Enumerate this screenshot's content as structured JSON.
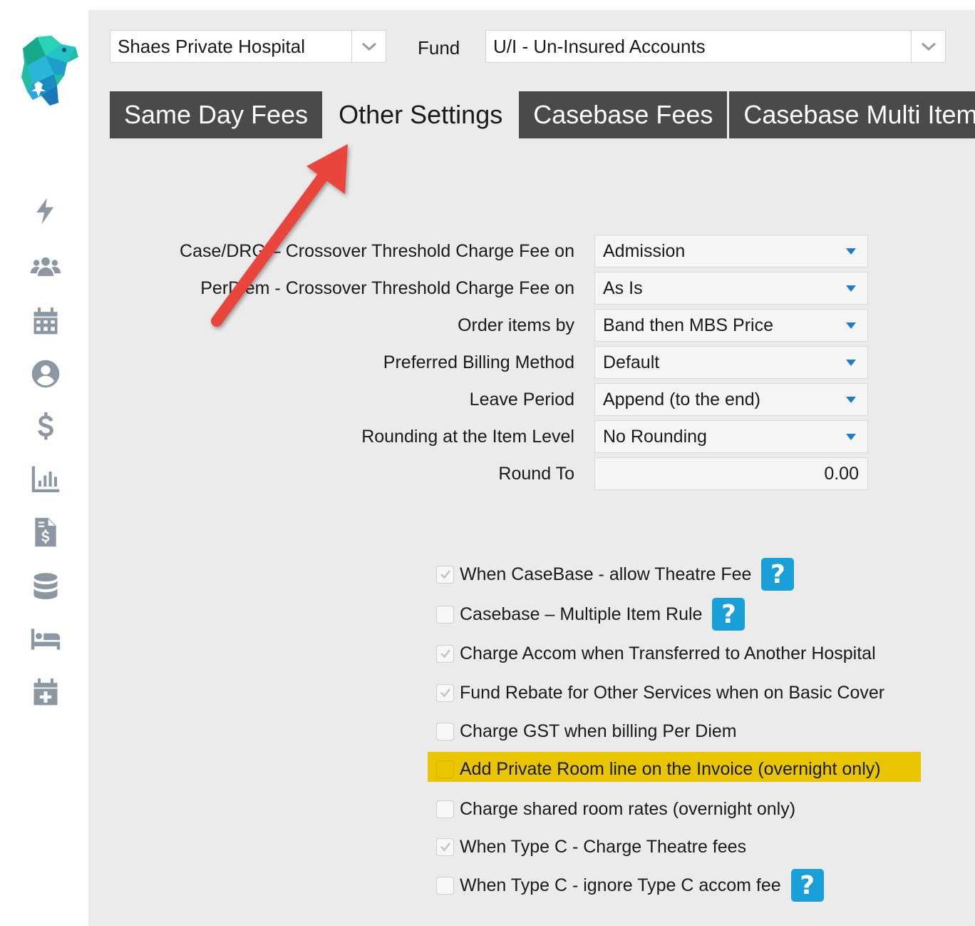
{
  "header": {
    "hospital_select": {
      "value": "Shaes Private Hospital"
    },
    "fund_label": "Fund",
    "fund_select": {
      "value": "U/I - Un-Insured Accounts"
    }
  },
  "tabs": [
    {
      "label": "Same Day Fees",
      "active": false
    },
    {
      "label": "Other Settings",
      "active": true
    },
    {
      "label": "Casebase Fees",
      "active": false
    },
    {
      "label": "Casebase Multi Item",
      "active": false
    }
  ],
  "sidebar": {
    "icons": [
      "bolt-icon",
      "users-icon",
      "calendar-icon",
      "user-circle-icon",
      "dollar-icon",
      "bar-chart-icon",
      "invoice-icon",
      "database-icon",
      "bed-icon",
      "calendar-plus-icon"
    ]
  },
  "settings": {
    "case_drg": {
      "label": "Case/DRG – Crossover Threshold Charge Fee on",
      "value": "Admission"
    },
    "per_diem": {
      "label": "PerDiem - Crossover Threshold Charge Fee on",
      "value": "As Is"
    },
    "order_items": {
      "label": "Order items by",
      "value": "Band then MBS Price"
    },
    "billing_method": {
      "label": "Preferred Billing Method",
      "value": "Default"
    },
    "leave_period": {
      "label": "Leave Period",
      "value": "Append (to the end)"
    },
    "rounding": {
      "label": "Rounding at the Item Level",
      "value": "No Rounding"
    },
    "round_to": {
      "label": "Round To",
      "value": "0.00"
    }
  },
  "checkboxes": [
    {
      "label": "When CaseBase - allow Theatre Fee",
      "checked": true,
      "help": true
    },
    {
      "label": "Casebase – Multiple Item Rule",
      "checked": false,
      "help": true
    },
    {
      "label": "Charge Accom when Transferred to Another Hospital",
      "checked": true,
      "help": false
    },
    {
      "label": "Fund Rebate for Other Services when on Basic Cover",
      "checked": true,
      "help": false
    },
    {
      "label": "Charge GST when billing Per Diem",
      "checked": false,
      "help": false
    },
    {
      "label": "Add Private Room line on the Invoice (overnight only)",
      "checked": false,
      "help": false,
      "highlighted": true
    },
    {
      "label": "Charge shared room rates (overnight only)",
      "checked": false,
      "help": false
    },
    {
      "label": "When Type C - Charge Theatre fees",
      "checked": true,
      "help": false
    },
    {
      "label": "When Type C - ignore Type C accom fee",
      "checked": false,
      "help": true
    }
  ],
  "help_glyph": "?",
  "colors": {
    "tab_dark": "#4a4a4a",
    "panel_bg": "#ebebeb",
    "help_blue": "#1aa0d8",
    "highlight_yellow": "#e8c500",
    "arrow_red": "#e8453c",
    "caret_blue": "#1c7fc4"
  }
}
